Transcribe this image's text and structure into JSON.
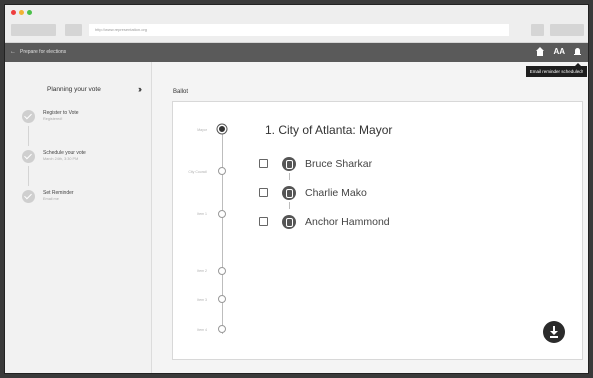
{
  "browser": {
    "url": "http://www.representation.org",
    "dot_colors": [
      "#ee3e3e",
      "#f2b233",
      "#4bc04a"
    ]
  },
  "appbar": {
    "back_icon": "arrow-left-icon",
    "title": "Prepare for elections",
    "text_size_label": "AA",
    "tooltip": "Email reminder scheduled!"
  },
  "sidebar": {
    "title": "Planning your vote",
    "collapse_icon": "double-chevron-right-icon",
    "steps": [
      {
        "title": "Register to Vote",
        "sub": "Registered!"
      },
      {
        "title": "Schedule your vote",
        "sub": "March 24th, 3:30 PM"
      },
      {
        "title": "Set Reminder",
        "sub": "Email me"
      }
    ]
  },
  "main": {
    "ballot_label": "Ballot",
    "timeline_labels": [
      "Mayor",
      "City Council",
      "Item 1",
      "Item 2",
      "Item 3",
      "Item 4"
    ],
    "race_title": "1. City of Atlanta: Mayor",
    "candidates": [
      {
        "name": "Bruce Sharkar"
      },
      {
        "name": "Charlie Mako"
      },
      {
        "name": "Anchor Hammond"
      }
    ],
    "fab_icon": "download-icon"
  }
}
